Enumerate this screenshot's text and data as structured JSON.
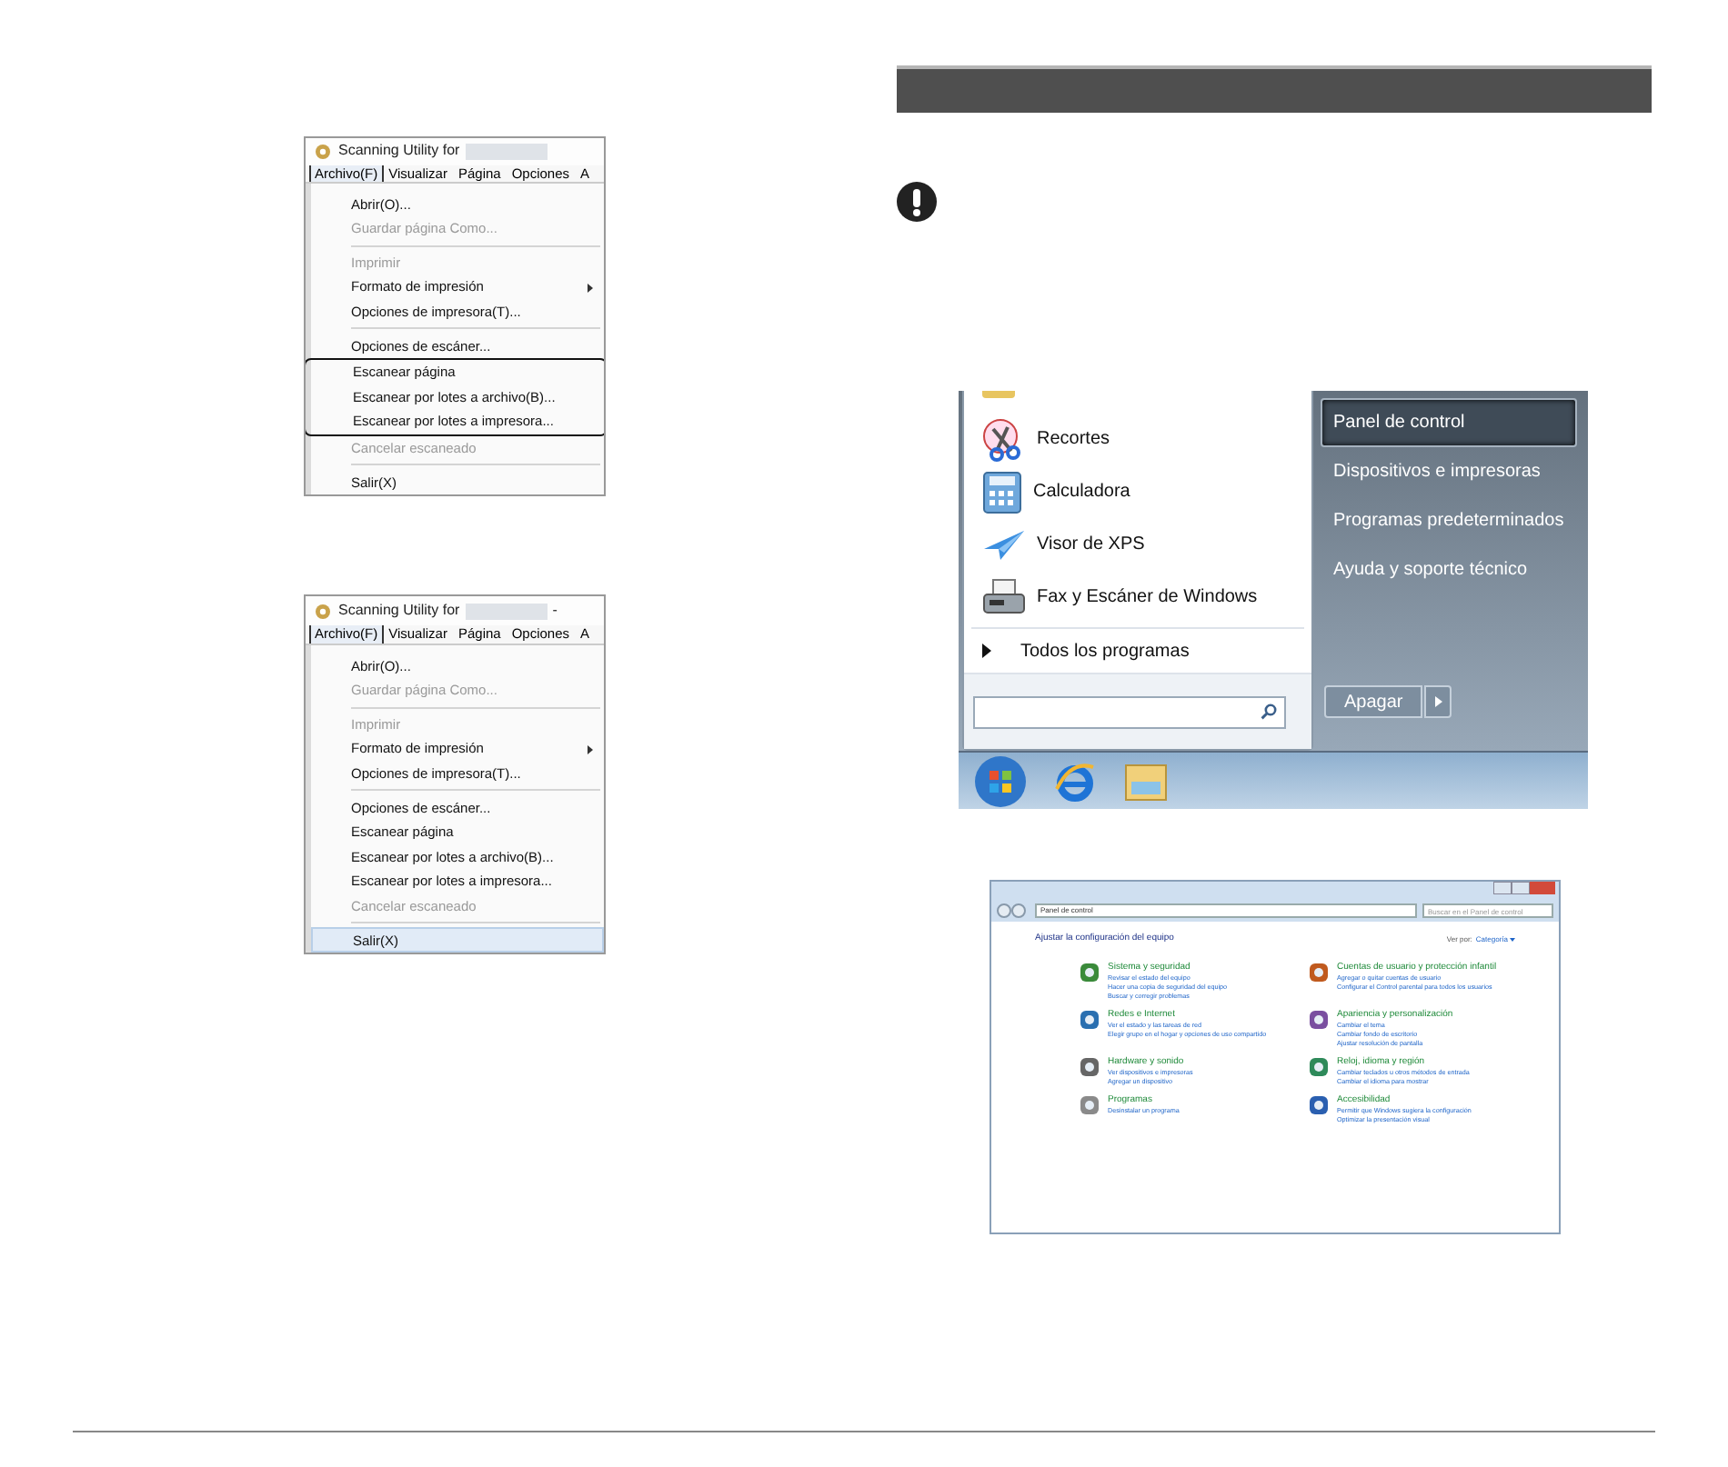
{
  "menu_screenshots": [
    {
      "title": "Scanning Utility for",
      "menubar": [
        {
          "label": "Archivo(F)",
          "selected": true
        },
        {
          "label": "Visualizar",
          "selected": false
        },
        {
          "label": "Página",
          "selected": false
        },
        {
          "label": "Opciones",
          "selected": false
        },
        {
          "label": "A",
          "selected": false
        }
      ],
      "items": [
        {
          "kind": "item",
          "label": "Abrir(O)...",
          "disabled": false,
          "submenu": false,
          "selected": false,
          "boxed": false
        },
        {
          "kind": "item",
          "label": "Guardar página Como...",
          "disabled": true,
          "submenu": false,
          "selected": false,
          "boxed": false
        },
        {
          "kind": "separator"
        },
        {
          "kind": "item",
          "label": "Imprimir",
          "disabled": true,
          "submenu": false,
          "selected": false,
          "boxed": false
        },
        {
          "kind": "item",
          "label": "Formato de impresión",
          "disabled": false,
          "submenu": true,
          "selected": false,
          "boxed": false
        },
        {
          "kind": "item",
          "label": "Opciones de impresora(T)...",
          "disabled": false,
          "submenu": false,
          "selected": false,
          "boxed": false
        },
        {
          "kind": "separator"
        },
        {
          "kind": "item",
          "label": "Opciones de escáner...",
          "disabled": false,
          "submenu": false,
          "selected": false,
          "boxed": false
        },
        {
          "kind": "item",
          "label": "Escanear página",
          "disabled": false,
          "submenu": false,
          "selected": false,
          "boxed": true
        },
        {
          "kind": "item",
          "label": "Escanear por lotes a archivo(B)...",
          "disabled": false,
          "submenu": false,
          "selected": false,
          "boxed": true
        },
        {
          "kind": "item",
          "label": "Escanear por lotes a impresora...",
          "disabled": false,
          "submenu": false,
          "selected": false,
          "boxed": true
        },
        {
          "kind": "item",
          "label": "Cancelar escaneado",
          "disabled": true,
          "submenu": false,
          "selected": false,
          "boxed": false
        },
        {
          "kind": "separator"
        },
        {
          "kind": "item",
          "label": "Salir(X)",
          "disabled": false,
          "submenu": false,
          "selected": false,
          "boxed": false
        }
      ]
    },
    {
      "title": "Scanning Utility for",
      "title_suffix": "-",
      "menubar": [
        {
          "label": "Archivo(F)",
          "selected": true
        },
        {
          "label": "Visualizar",
          "selected": false
        },
        {
          "label": "Página",
          "selected": false
        },
        {
          "label": "Opciones",
          "selected": false
        },
        {
          "label": "A",
          "selected": false
        }
      ],
      "items": [
        {
          "kind": "item",
          "label": "Abrir(O)...",
          "disabled": false,
          "submenu": false,
          "selected": false,
          "boxed": false
        },
        {
          "kind": "item",
          "label": "Guardar página Como...",
          "disabled": true,
          "submenu": false,
          "selected": false,
          "boxed": false
        },
        {
          "kind": "separator"
        },
        {
          "kind": "item",
          "label": "Imprimir",
          "disabled": true,
          "submenu": false,
          "selected": false,
          "boxed": false
        },
        {
          "kind": "item",
          "label": "Formato de impresión",
          "disabled": false,
          "submenu": true,
          "selected": false,
          "boxed": false
        },
        {
          "kind": "item",
          "label": "Opciones de impresora(T)...",
          "disabled": false,
          "submenu": false,
          "selected": false,
          "boxed": false
        },
        {
          "kind": "separator"
        },
        {
          "kind": "item",
          "label": "Opciones de escáner...",
          "disabled": false,
          "submenu": false,
          "selected": false,
          "boxed": false
        },
        {
          "kind": "item",
          "label": "Escanear página",
          "disabled": false,
          "submenu": false,
          "selected": false,
          "boxed": false
        },
        {
          "kind": "item",
          "label": "Escanear por lotes a archivo(B)...",
          "disabled": false,
          "submenu": false,
          "selected": false,
          "boxed": false
        },
        {
          "kind": "item",
          "label": "Escanear por lotes a impresora...",
          "disabled": false,
          "submenu": false,
          "selected": false,
          "boxed": false
        },
        {
          "kind": "item",
          "label": "Cancelar escaneado",
          "disabled": true,
          "submenu": false,
          "selected": false,
          "boxed": false
        },
        {
          "kind": "separator"
        },
        {
          "kind": "item",
          "label": "Salir(X)",
          "disabled": false,
          "submenu": false,
          "selected": true,
          "boxed": false
        }
      ]
    }
  ],
  "start_menu": {
    "programs": [
      "Recortes",
      "Calculadora",
      "Visor de XPS",
      "Fax y Escáner de Windows"
    ],
    "all_programs": "Todos los programas",
    "right_items": [
      {
        "label": "Panel de control",
        "selected": true
      },
      {
        "label": "Dispositivos e impresoras",
        "selected": false
      },
      {
        "label": "Programas predeterminados",
        "selected": false
      },
      {
        "label": "Ayuda y soporte técnico",
        "selected": false
      }
    ],
    "shutdown": "Apagar"
  },
  "control_panel": {
    "breadcrumb": "Panel de control",
    "search_placeholder": "Buscar en el Panel de control",
    "heading": "Ajustar la configuración del equipo",
    "view_by_label": "Ver por:",
    "view_by_value": "Categoría",
    "categories": [
      {
        "title": "Sistema y seguridad",
        "links": [
          "Revisar el estado del equipo",
          "Hacer una copia de seguridad del equipo",
          "Buscar y corregir problemas"
        ]
      },
      {
        "title": "Cuentas de usuario y protección infantil",
        "links": [
          "Agregar o quitar cuentas de usuario",
          "Configurar el Control parental para todos los usuarios"
        ]
      },
      {
        "title": "Redes e Internet",
        "links": [
          "Ver el estado y las tareas de red",
          "Elegir grupo en el hogar y opciones de uso compartido"
        ]
      },
      {
        "title": "Apariencia y personalización",
        "links": [
          "Cambiar el tema",
          "Cambiar fondo de escritorio",
          "Ajustar resolución de pantalla"
        ]
      },
      {
        "title": "Hardware y sonido",
        "links": [
          "Ver dispositivos e impresoras",
          "Agregar un dispositivo"
        ]
      },
      {
        "title": "Reloj, idioma y región",
        "links": [
          "Cambiar teclados u otros métodos de entrada",
          "Cambiar el idioma para mostrar"
        ]
      },
      {
        "title": "Programas",
        "links": [
          "Desinstalar un programa"
        ]
      },
      {
        "title": "Accesibilidad",
        "links": [
          "Permitir que Windows sugiera la configuración",
          "Optimizar la presentación visual"
        ]
      }
    ]
  }
}
